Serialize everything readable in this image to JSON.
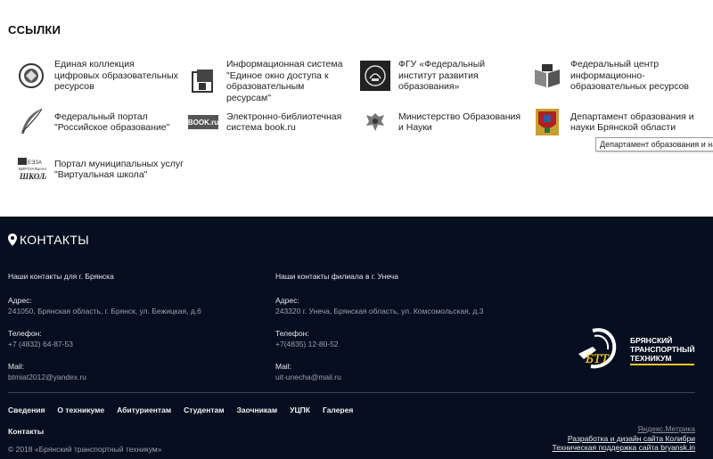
{
  "links": {
    "title": "ССЫЛКИ",
    "items": [
      {
        "text": "Единая коллекция цифровых образовательных ресурсов",
        "icon": "collection-icon"
      },
      {
        "text": "Информационная система \"Единое окно доступа к образовательным ресурсам\"",
        "icon": "window-icon"
      },
      {
        "text": "ФГУ «Федеральный институт развития образования»",
        "icon": "firo-icon"
      },
      {
        "text": "Федеральный центр информационно-образовательных ресурсов",
        "icon": "book-icon"
      },
      {
        "text": "Федеральный портал \"Российское образование\"",
        "icon": "feather-icon"
      },
      {
        "text": "Электронно-библиотечная система book.ru",
        "icon": "bookru-icon"
      },
      {
        "text": "Министерство Образования и Науки",
        "icon": "eagle-icon"
      },
      {
        "text": "Департамент образования и науки Брянской области",
        "icon": "coat-of-arms-icon"
      },
      {
        "text": "Портал муниципальных услуг \"Виртуальная школа\"",
        "icon": "virtual-school-icon"
      }
    ],
    "tooltip": "Департамент образования и науки"
  },
  "contacts": {
    "title": "КОНТАКТЫ",
    "bryansk": {
      "heading": "Наши контакты для г. Брянска",
      "address_label": "Адрес:",
      "address": "241050, Брянская область, г. Брянск, ул. Бежицкая, д.6",
      "phone_label": "Телефон:",
      "phone": "+7 (4832) 64-87-53",
      "mail_label": "Mail:",
      "mail": "btmiat2012@yandex.ru"
    },
    "unecha": {
      "heading": "Наши контакты филиала в г. Унеча",
      "address_label": "Адрес:",
      "address": "243320 г. Унеча, Брянская область, ул. Комсомольская, д.3",
      "phone_label": "Телефон:",
      "phone": "+7(4835) 12-80-52",
      "mail_label": "Mail:",
      "mail": "uit-unecha@mail.ru"
    },
    "logo": {
      "abbr": "БТТ",
      "line1": "БРЯНСКИЙ",
      "line2": "ТРАНСПОРТНЫЙ",
      "line3": "ТЕХНИКУМ"
    }
  },
  "footer": {
    "nav": [
      "Сведения",
      "О техникуме",
      "Абитуриентам",
      "Студентам",
      "Заочникам",
      "УЦПК",
      "Галерея"
    ],
    "contacts": "Контакты",
    "copyright": "© 2018 «Брянский транспортный техникум»",
    "metrika": "Яндекс.Метрика",
    "dev1": "Разработка и дизайн сайта Колибри",
    "dev2": "Техническая поддержка сайта bryansk.in"
  }
}
